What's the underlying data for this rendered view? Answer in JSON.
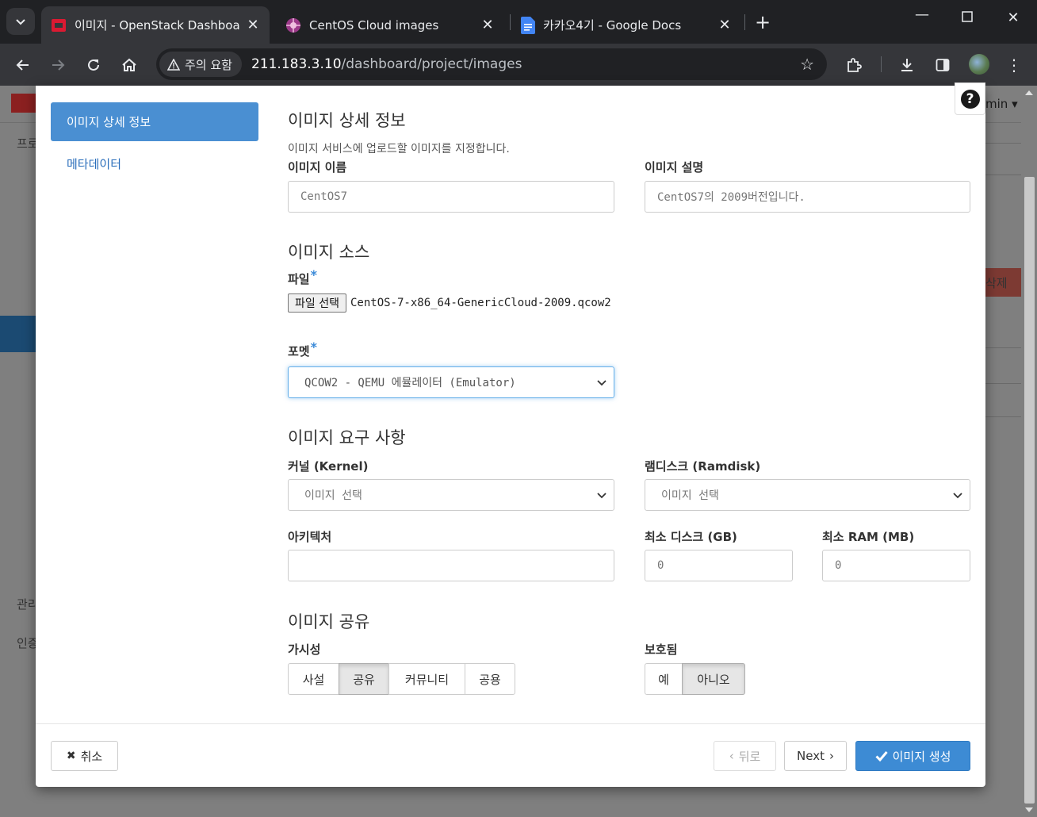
{
  "browser": {
    "tabs": [
      {
        "title": "이미지 - OpenStack Dashboard",
        "active": true
      },
      {
        "title": "CentOS Cloud images",
        "active": false
      },
      {
        "title": "카카오4기 - Google Docs",
        "active": false
      }
    ],
    "security_chip": "주의 요함",
    "url_host": "211.183.3.10",
    "url_path": "/dashboard/project/images"
  },
  "background_page": {
    "user_menu": "min",
    "delete_button": "삭제",
    "sidebar_fragments": [
      "프로",
      "관리",
      "인증"
    ]
  },
  "wizard": {
    "steps": [
      {
        "label": "이미지 상세 정보",
        "active": true
      },
      {
        "label": "메타데이터",
        "active": false
      }
    ],
    "help_button": "?"
  },
  "details": {
    "title": "이미지 상세 정보",
    "help": "이미지 서비스에 업로드할 이미지를 지정합니다.",
    "name_label": "이미지 이름",
    "name_value": "CentOS7",
    "desc_label": "이미지 설명",
    "desc_value": "CentOS7의 2009버전입니다."
  },
  "source": {
    "title": "이미지 소스",
    "file_label": "파일",
    "file_button": "파일 선택",
    "file_name": "CentOS-7-x86_64-GenericCloud-2009.qcow2",
    "format_label": "포멧",
    "format_value": "QCOW2 - QEMU 에뮬레이터 (Emulator)",
    "required_mark": "*"
  },
  "requirements": {
    "title": "이미지 요구 사항",
    "kernel_label": "커널 (Kernel)",
    "kernel_value": "이미지 선택",
    "ramdisk_label": "램디스크 (Ramdisk)",
    "ramdisk_value": "이미지 선택",
    "arch_label": "아키텍처",
    "arch_value": "",
    "min_disk_label": "최소 디스크 (GB)",
    "min_disk_value": "0",
    "min_ram_label": "최소 RAM (MB)",
    "min_ram_value": "0"
  },
  "sharing": {
    "title": "이미지 공유",
    "visibility_label": "가시성",
    "visibility_options": [
      "사설",
      "공유",
      "커뮤니티",
      "공용"
    ],
    "visibility_selected": "공유",
    "protected_label": "보호됨",
    "protected_options": [
      "예",
      "아니오"
    ],
    "protected_selected": "아니오"
  },
  "footer": {
    "cancel": "취소",
    "back": "뒤로",
    "next": "Next",
    "create": "이미지 생성"
  },
  "colors": {
    "accent": "#4a8fd2",
    "primary_button": "#3d8bd4",
    "required": "#3b8ad8",
    "brand_red": "#da1a32"
  }
}
